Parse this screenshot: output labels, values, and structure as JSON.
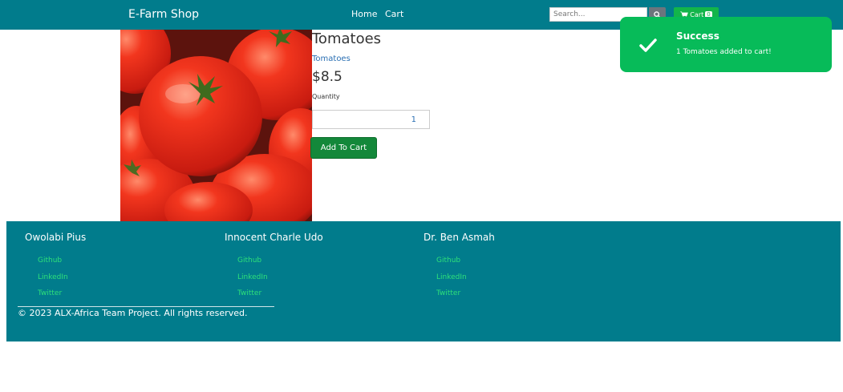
{
  "navbar": {
    "brand": "E-Farm Shop",
    "home_label": "Home",
    "cart_label": "Cart",
    "search_placeholder": "Search...",
    "cart_button_label": "Cart",
    "cart_count": "0"
  },
  "product": {
    "title": "Tomatoes",
    "category": "Tomatoes",
    "price": "$8.5",
    "quantity_label": "Quantity",
    "quantity_value": "1",
    "add_button_label": "Add To Cart"
  },
  "toast": {
    "title": "Success",
    "message": "1 Tomatoes added to cart!"
  },
  "footer": {
    "columns": [
      {
        "name": "Owolabi Pius",
        "links": [
          "Github",
          "LinkedIn",
          "Twitter"
        ]
      },
      {
        "name": "Innocent Charle Udo",
        "links": [
          "Github",
          "LinkedIn",
          "Twitter"
        ]
      },
      {
        "name": "Dr. Ben Asmah",
        "links": [
          "Github",
          "LinkedIn",
          "Twitter"
        ]
      }
    ],
    "copyright": "© 2023 ALX-Africa Team Project. All rights reserved."
  },
  "colors": {
    "navbar_bg": "#017c8c",
    "toast_bg": "#07bb59",
    "add_button_bg": "#13883a",
    "link_green": "#2ee07a"
  }
}
